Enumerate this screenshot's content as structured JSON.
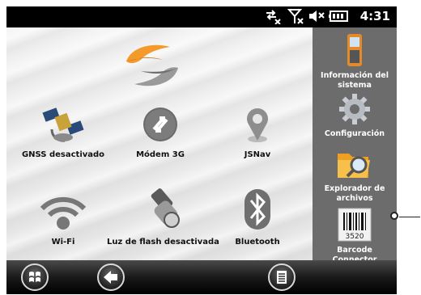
{
  "status_bar": {
    "time": "4:31",
    "icons": [
      "sync-disconnected-icon",
      "signal-off-icon",
      "speaker-muted-icon",
      "battery-icon"
    ]
  },
  "launcher": {
    "logo": "app-logo-icon",
    "apps": [
      {
        "label": "GNSS desactivado",
        "icon": "satellite-icon"
      },
      {
        "label": "Módem 3G",
        "icon": "modem-3g-icon"
      },
      {
        "label": "JSNav",
        "icon": "map-pin-icon"
      },
      {
        "label": "Wi-Fi",
        "icon": "wifi-icon"
      },
      {
        "label": "Luz de flash desactivada",
        "icon": "flashlight-icon"
      },
      {
        "label": "Bluetooth",
        "icon": "bluetooth-icon"
      }
    ]
  },
  "side_panel": {
    "items": [
      {
        "label_line1": "Información del",
        "label_line2": "sistema",
        "icon": "device-info-icon"
      },
      {
        "label_line1": "Configuración",
        "label_line2": "",
        "icon": "gear-icon"
      },
      {
        "label_line1": "Explorador de",
        "label_line2": "archivos",
        "icon": "folder-search-icon"
      },
      {
        "label_line1": "Barcode",
        "label_line2": "Connector",
        "icon": "barcode-icon",
        "barcode_number": "3520"
      }
    ]
  },
  "taskbar": {
    "buttons": [
      "windows-start-icon",
      "back-arrow-icon",
      "menu-icon"
    ]
  },
  "colors": {
    "side_panel_bg": "#6c6c6c",
    "logo_orange": "#f39a2b",
    "logo_gray": "#8f8f8f"
  }
}
